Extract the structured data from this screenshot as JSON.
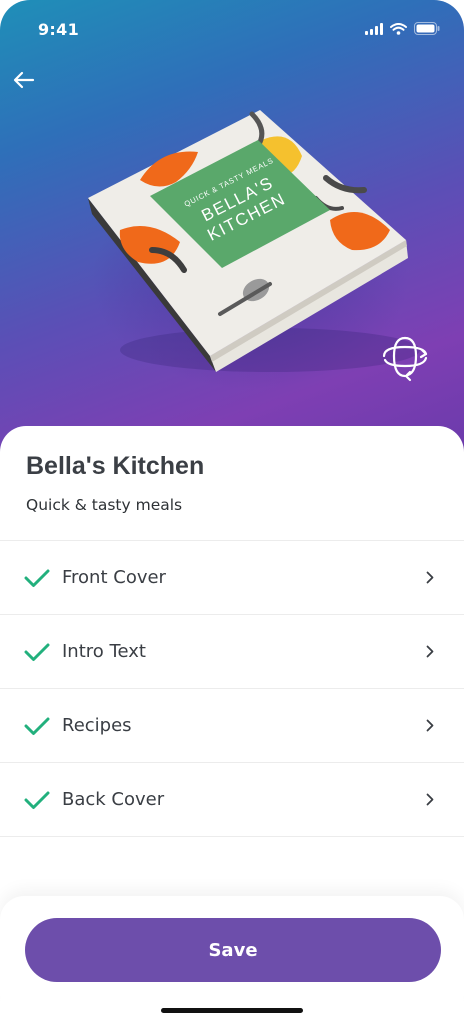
{
  "status_bar": {
    "time": "9:41",
    "icons": [
      "signal-icon",
      "wifi-icon",
      "battery-icon"
    ]
  },
  "header": {
    "back_icon": "arrow-left-icon",
    "rotate_icon": "rotate-3d-icon"
  },
  "book_cover": {
    "tagline": "QUICK & TASTY MEALS",
    "title_line1": "BELLA'S",
    "title_line2": "KITCHEN"
  },
  "project": {
    "title": "Bella's Kitchen",
    "subtitle": "Quick & tasty meals"
  },
  "steps": [
    {
      "label": "Front Cover",
      "completed": true
    },
    {
      "label": "Intro Text",
      "completed": true
    },
    {
      "label": "Recipes",
      "completed": true
    },
    {
      "label": "Back Cover",
      "completed": true
    }
  ],
  "footer": {
    "save_label": "Save"
  },
  "colors": {
    "accent": "#6d4eab",
    "check": "#22b07d",
    "cover_green": "#5aa86b",
    "cover_orange": "#f0691a"
  }
}
